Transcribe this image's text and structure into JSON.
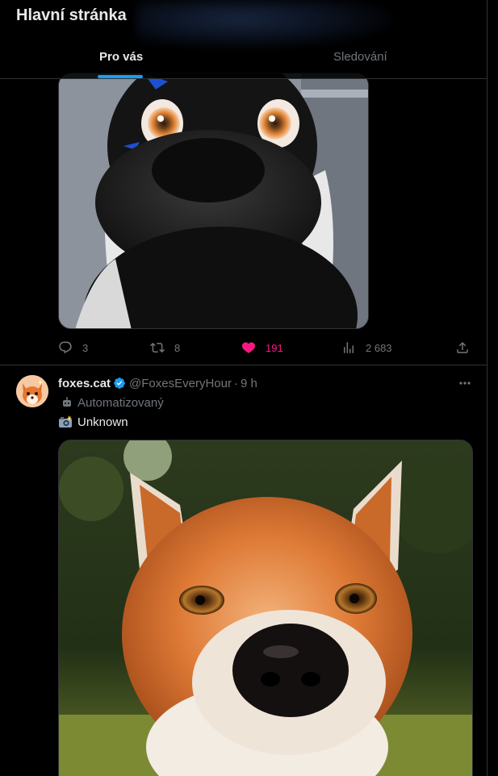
{
  "header": {
    "title": "Hlavní stránka",
    "tabs": [
      {
        "label": "Pro vás",
        "active": true
      },
      {
        "label": "Sledování",
        "active": false
      }
    ]
  },
  "tweet_1": {
    "image_icon": "fursuit-selfie-photo",
    "actions": {
      "replies": "3",
      "reposts": "8",
      "likes": "191",
      "views": "2 683",
      "liked": true
    }
  },
  "tweet_2": {
    "display_name": "foxes.cat",
    "verified": true,
    "handle": "@FoxesEveryHour",
    "separator": "·",
    "time": "9 h",
    "automated_label": "Automatizovaný",
    "text": "Unknown",
    "text_icon": "camera-flash-emoji",
    "image_icon": "fox-closeup-photo"
  },
  "colors": {
    "accent": "#1d9bf0",
    "like": "#f91880",
    "muted": "#71767b",
    "border": "#2f3336"
  }
}
